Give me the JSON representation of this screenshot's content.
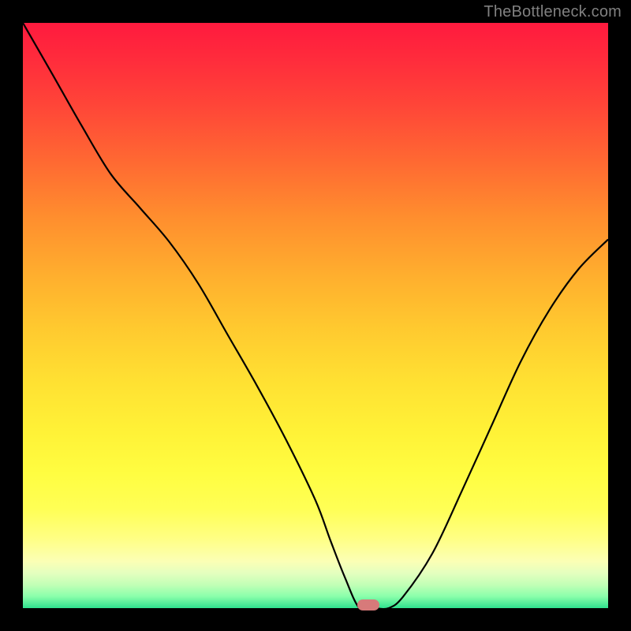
{
  "watermark": "TheBottleneck.com",
  "colors": {
    "background": "#000000",
    "marker": "#d77a7a",
    "curve": "#000000"
  },
  "chart_data": {
    "type": "line",
    "title": "",
    "xlabel": "",
    "ylabel": "",
    "x": [
      0.0,
      0.05,
      0.1,
      0.15,
      0.2,
      0.25,
      0.3,
      0.35,
      0.4,
      0.45,
      0.5,
      0.525,
      0.55,
      0.575,
      0.6,
      0.625,
      0.65,
      0.7,
      0.75,
      0.8,
      0.85,
      0.9,
      0.95,
      1.0
    ],
    "values": [
      1.0,
      0.913,
      0.825,
      0.742,
      0.684,
      0.626,
      0.554,
      0.467,
      0.38,
      0.287,
      0.184,
      0.117,
      0.053,
      0.0,
      0.0,
      0.0,
      0.02,
      0.094,
      0.2,
      0.31,
      0.42,
      0.51,
      0.58,
      0.63
    ],
    "xlim": [
      0,
      1
    ],
    "ylim": [
      0,
      1
    ],
    "marker": {
      "x": 0.59,
      "y": 0.0
    },
    "grid": false,
    "legend": false
  }
}
